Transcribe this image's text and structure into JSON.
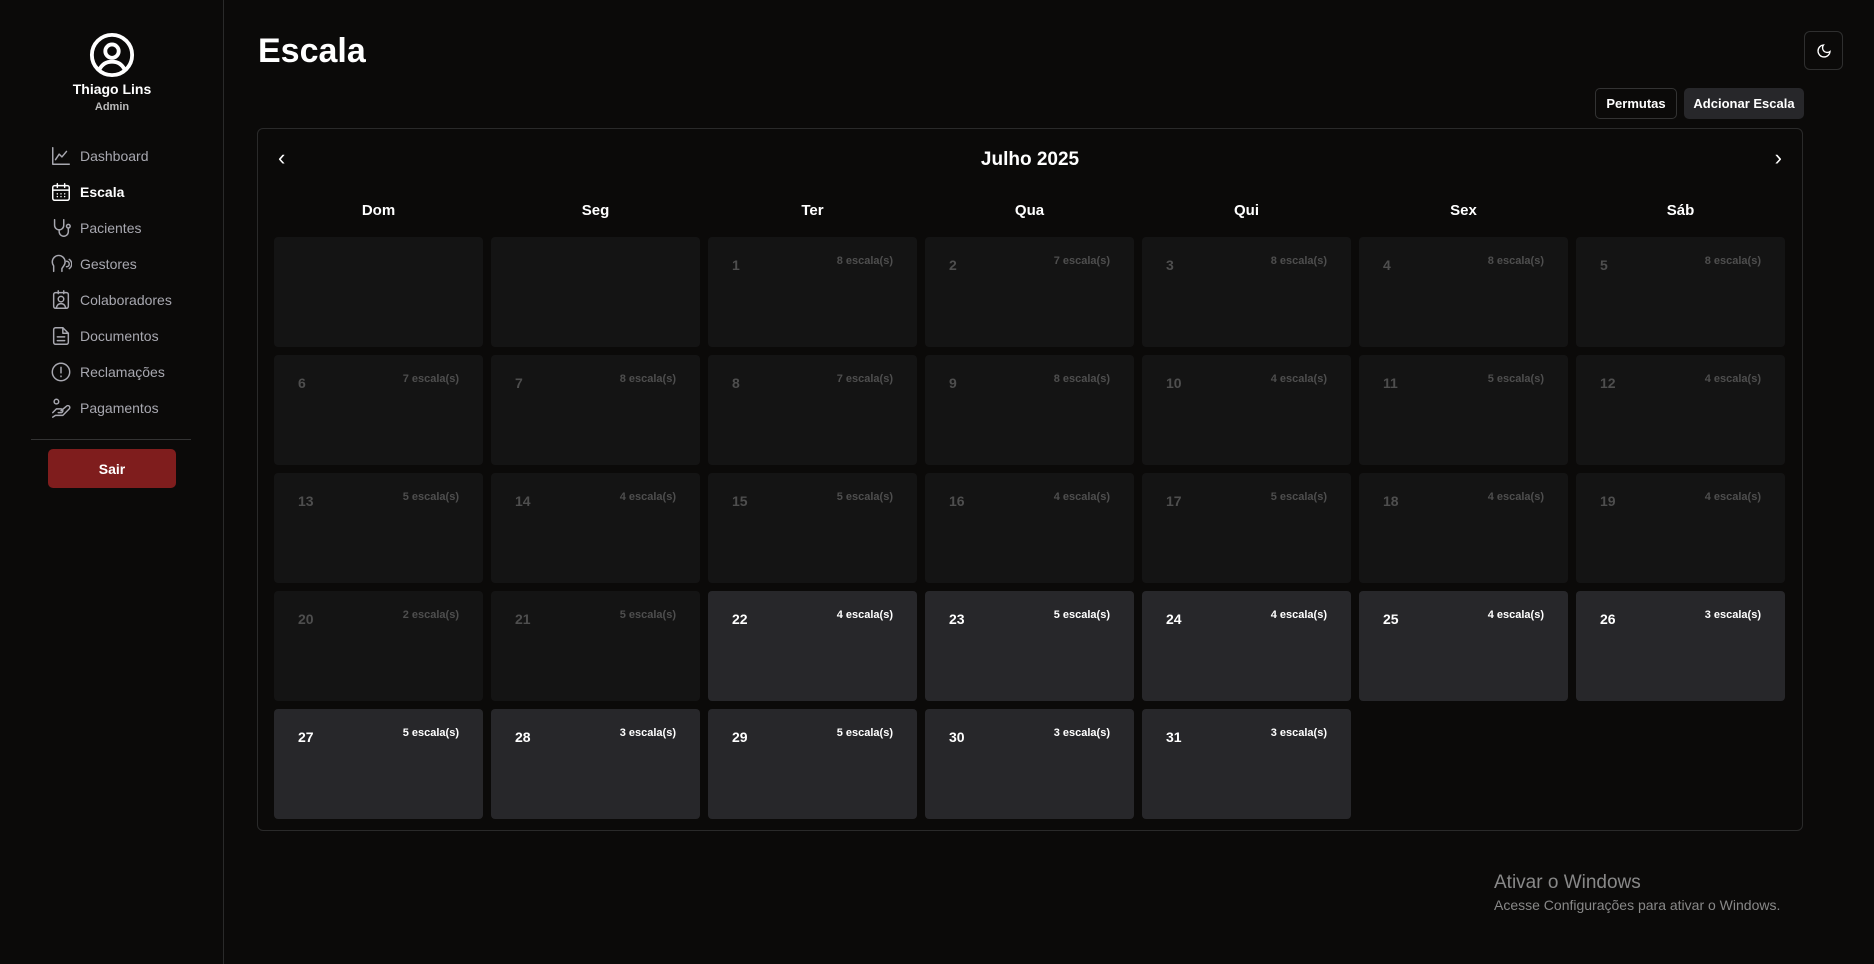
{
  "user": {
    "name": "Thiago Lins",
    "role": "Admin"
  },
  "nav": [
    {
      "label": "Dashboard",
      "icon": "chart-line-icon"
    },
    {
      "label": "Escala",
      "icon": "calendar-icon",
      "active": true
    },
    {
      "label": "Pacientes",
      "icon": "stethoscope-icon"
    },
    {
      "label": "Gestores",
      "icon": "speaking-head-icon"
    },
    {
      "label": "Colaboradores",
      "icon": "badge-user-icon"
    },
    {
      "label": "Documentos",
      "icon": "document-icon"
    },
    {
      "label": "Reclamações",
      "icon": "alert-circle-icon"
    },
    {
      "label": "Pagamentos",
      "icon": "hand-coins-icon"
    }
  ],
  "logout_label": "Sair",
  "page_title": "Escala",
  "buttons": {
    "permutas": "Permutas",
    "add": "Adcionar Escala"
  },
  "calendar": {
    "month_label": "Julho 2025",
    "weekdays": [
      "Dom",
      "Seg",
      "Ter",
      "Qua",
      "Qui",
      "Sex",
      "Sáb"
    ],
    "leading_blanks": 2,
    "today": 22,
    "count_suffix": " escala(s)",
    "counts": [
      8,
      7,
      8,
      8,
      8,
      7,
      8,
      7,
      8,
      4,
      5,
      4,
      5,
      4,
      5,
      4,
      5,
      4,
      4,
      2,
      5,
      4,
      5,
      4,
      4,
      3,
      5,
      3,
      5,
      3,
      3
    ]
  },
  "watermark": {
    "title": "Ativar o Windows",
    "subtitle": "Acesse Configurações para ativar o Windows."
  }
}
